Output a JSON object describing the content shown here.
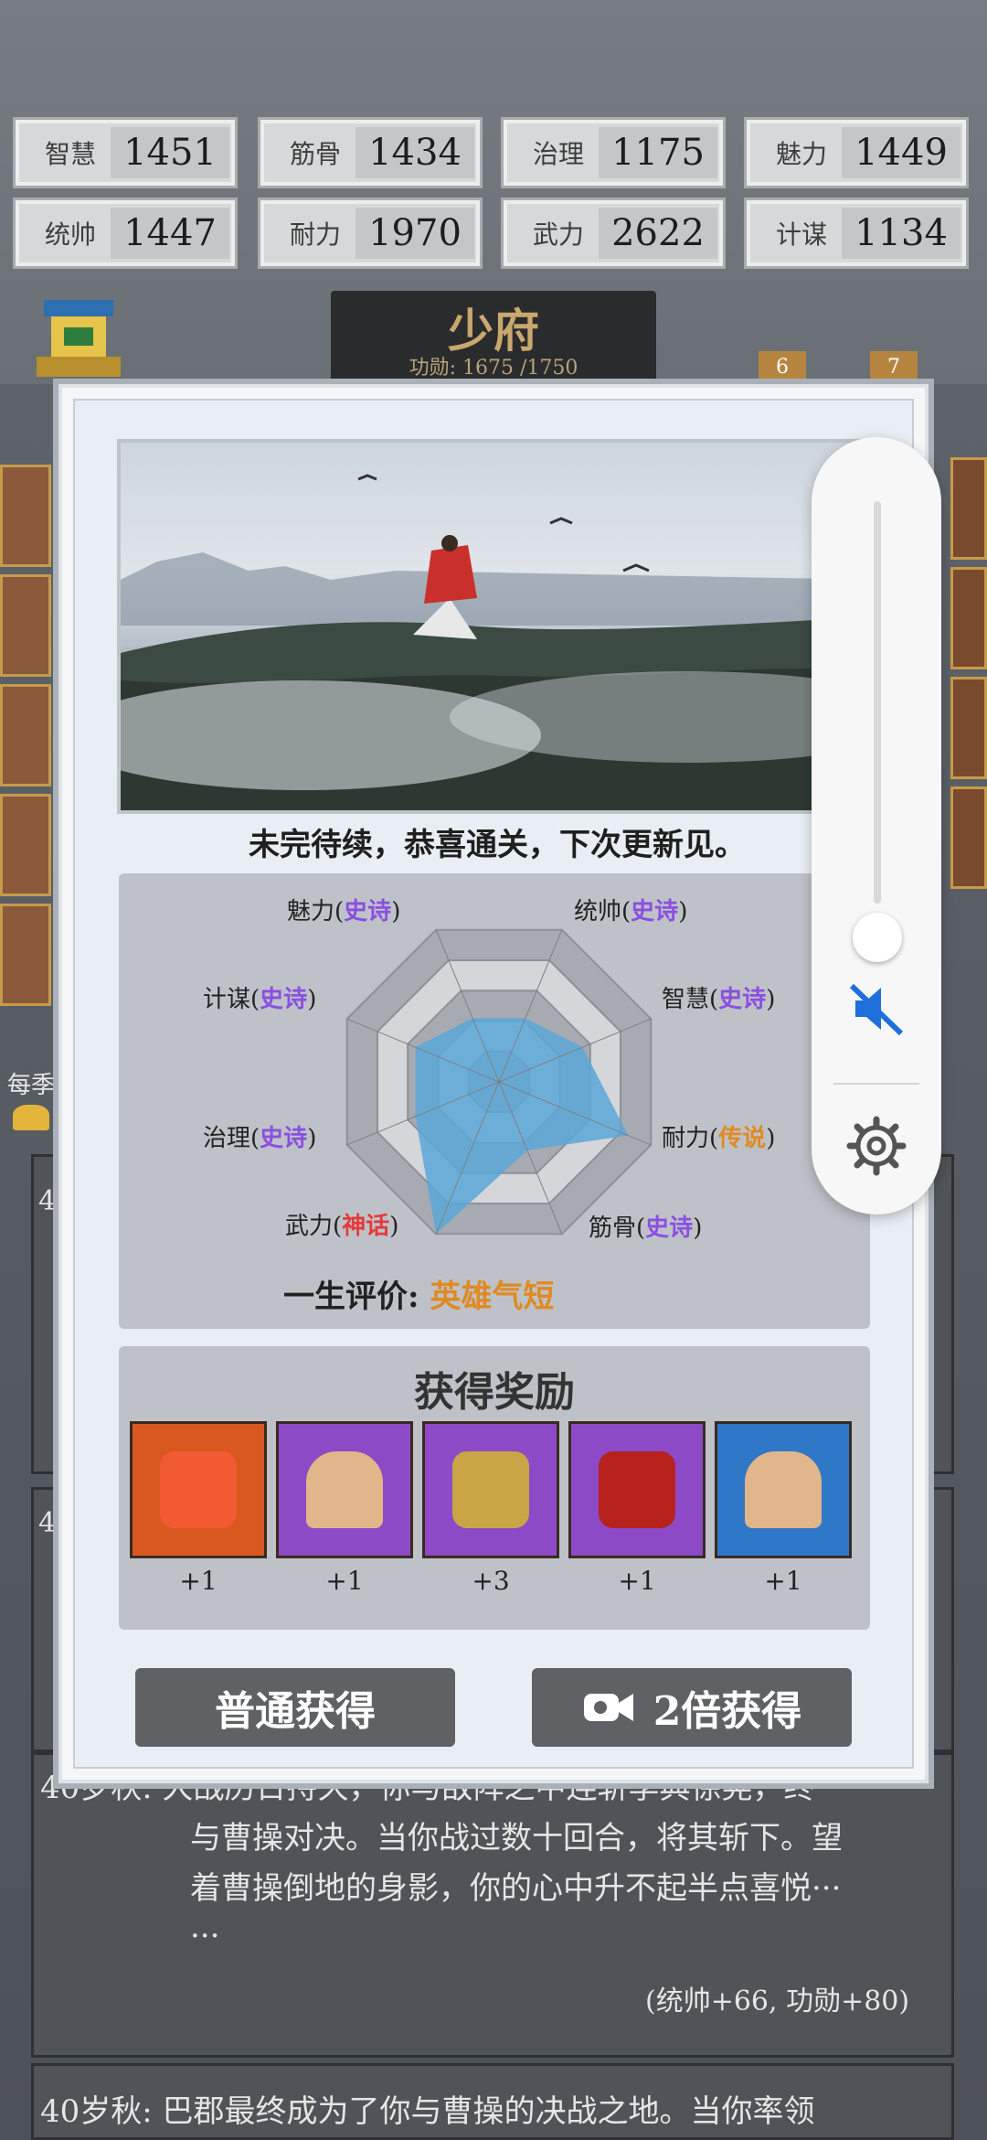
{
  "stats": [
    {
      "label": "智慧",
      "value": "1451"
    },
    {
      "label": "筋骨",
      "value": "1434"
    },
    {
      "label": "治理",
      "value": "1175"
    },
    {
      "label": "魅力",
      "value": "1449"
    },
    {
      "label": "统帅",
      "value": "1447"
    },
    {
      "label": "耐力",
      "value": "1970"
    },
    {
      "label": "武力",
      "value": "2622"
    },
    {
      "label": "计谋",
      "value": "1134"
    }
  ],
  "rank": {
    "title": "少府",
    "merit": "功勋: 1675 /1750"
  },
  "background": {
    "badge_6": "6",
    "badge_7": "7",
    "side_label": "每季",
    "story_age_1": "40",
    "story_age_2": "40",
    "story_1": {
      "line1": "40岁秋:  大战历日持久，你与敌阵之中连斩李典徐晃，终",
      "line2": "与曹操对决。当你战过数十回合，将其斩下。望",
      "line3": "着曹操倒地的身影，你的心中升不起半点喜悦···",
      "line4": "···",
      "reward": "(统帅+66, 功勋+80)"
    },
    "story_2": {
      "line1": "40岁秋:  巴郡最终成为了你与曹操的决战之地。当你率领"
    }
  },
  "modal": {
    "caption": "未完待续，恭喜通关，下次更新见。",
    "radar": {
      "axes": [
        {
          "name": "统帅",
          "tier": "史诗",
          "tier_color": "#8b4fe0"
        },
        {
          "name": "智慧",
          "tier": "史诗",
          "tier_color": "#8b4fe0"
        },
        {
          "name": "耐力",
          "tier": "传说",
          "tier_color": "#e08a22"
        },
        {
          "name": "筋骨",
          "tier": "史诗",
          "tier_color": "#8b4fe0"
        },
        {
          "name": "武力",
          "tier": "神话",
          "tier_color": "#e23b3b"
        },
        {
          "name": "治理",
          "tier": "史诗",
          "tier_color": "#8b4fe0"
        },
        {
          "name": "计谋",
          "tier": "史诗",
          "tier_color": "#8b4fe0"
        },
        {
          "name": "魅力",
          "tier": "史诗",
          "tier_color": "#8b4fe0"
        }
      ],
      "fill_color": "#5aa7d8"
    },
    "evaluation_label": "一生评价:",
    "evaluation_value": "英雄气短",
    "reward_title": "获得奖励",
    "rewards": [
      {
        "icon": "puzzle-piece-icon",
        "count": "+1"
      },
      {
        "icon": "hero-portrait-icon",
        "count": "+1"
      },
      {
        "icon": "treasure-box-icon",
        "count": "+3"
      },
      {
        "icon": "lantern-icon",
        "count": "+1"
      },
      {
        "icon": "hero-portrait-icon",
        "count": "+1"
      }
    ],
    "btn_normal": "普通获得",
    "btn_double": "2倍获得"
  },
  "volume": {
    "level": 0.0,
    "muted": true,
    "accent": "#1e6fd9"
  }
}
